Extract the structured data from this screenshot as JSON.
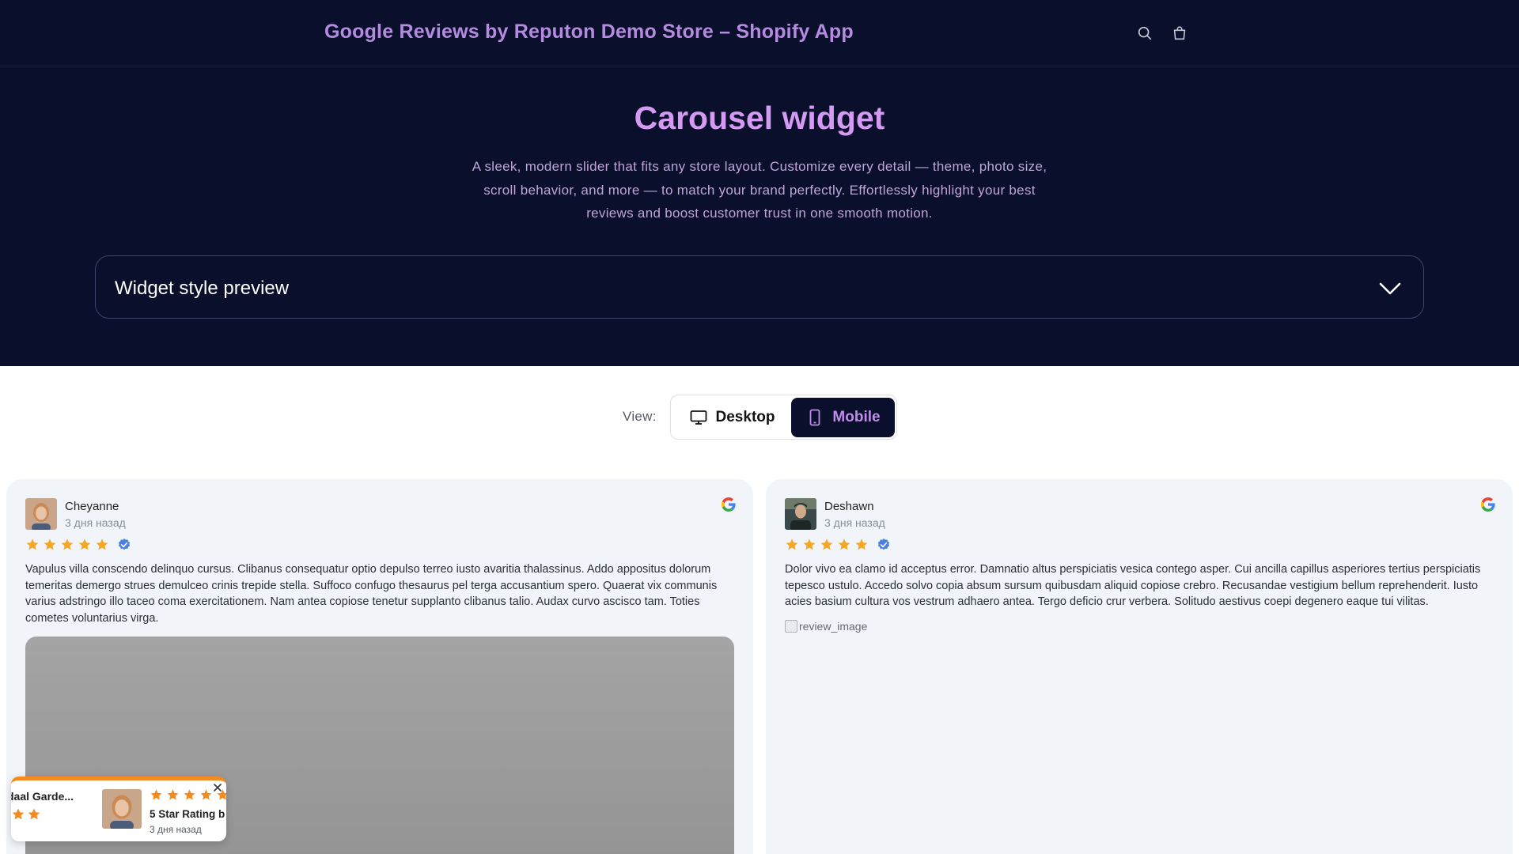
{
  "header": {
    "store_title": "Google Reviews by Reputon Demo Store – Shopify App",
    "icons": [
      "search-icon",
      "cart-icon"
    ]
  },
  "hero": {
    "title": "Carousel widget",
    "description": "A sleek, modern slider that fits any store layout. Customize every detail — theme, photo size, scroll behavior, and more — to match your brand perfectly. Effortlessly highlight your best reviews and boost customer trust in one smooth motion.",
    "accordion_label": "Widget style preview"
  },
  "view_toggle": {
    "label": "View:",
    "desktop_label": "Desktop",
    "mobile_label": "Mobile",
    "selected": "Mobile"
  },
  "reviews": [
    {
      "name": "Cheyanne",
      "date": "3 дня назад",
      "rating": 5,
      "verified": true,
      "source_icon": "google-icon",
      "text": "Vapulus villa conscendo delinquo cursus. Clibanus consequatur optio depulso terreo iusto avaritia thalassinus. Addo appositus dolorum temeritas demergo strues demulceo crinis trepide stella. Suffoco confugo thesaurus pel terga accusantium spero. Quaerat vix communis varius adstringo illo taceo coma exercitationem. Nam antea copiose tenetur supplanto clibanus talio. Audax curvo ascisco tam. Toties cometes voluntarius virga."
    },
    {
      "name": "Deshawn",
      "date": "3 дня назад",
      "rating": 5,
      "verified": true,
      "source_icon": "google-icon",
      "text": "Dolor vivo ea clamo id acceptus error. Damnatio altus perspiciatis vesica contego asper. Cui ancilla capillus asperiores tertius perspiciatis tepesco ustulo. Accedo solvo copia absum sursum quibusdam aliquid copiose crebro. Recusandae vestigium bellum reprehenderit. Iusto acies basium cultura vos vestrum adhaero antea. Tergo deficio crur verbera. Solitudo aestivus coepi degenero eaque tui vilitas.",
      "image_alt": "review_image"
    }
  ],
  "popup": {
    "store_name": "daal Garde...",
    "rating_text": "5 Star Rating b",
    "date": "3 дня назад"
  },
  "colors": {
    "header_bg": "#0a0f2c",
    "accent_purple": "#d59af2",
    "star": "#f5a623",
    "verified": "#4a7fe0",
    "popup_accent": "#f58a1f"
  }
}
